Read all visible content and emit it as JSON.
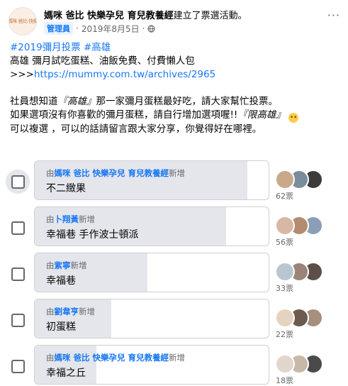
{
  "post": {
    "avatar_text": "媽咪 爸比 快樂",
    "author": "媽咪 爸比 快樂孕兒 育兒教養經",
    "action": "建立了票選活動。",
    "badge": "管理員",
    "date": "2019年8月5日",
    "separator": "·",
    "more_label": "···",
    "hashtags": "#2019彌月投票 #高雄",
    "line1": "高雄 彌月試吃蛋糕、油飯免費、付費懶人包",
    "link_prefix": ">>>",
    "link_url": "https://mummy.com.tw/archives/2965",
    "p2_a": "社員想知道",
    "p2_em": "『高雄』",
    "p2_b": "那一家彌月蛋糕最好吃，請大家幫忙投票。",
    "p3_a": "如果選項沒有你喜歡的彌月蛋糕，請自行增加選項喔!!",
    "p3_em": "『限高雄』",
    "p4": "可以複選 ，可以的話請留言跟大家分享，你覺得好在哪裡。"
  },
  "poll": {
    "by_prefix": "由",
    "added_suffix": "新增",
    "options": [
      {
        "adder": "媽咪 爸比 快樂孕兒 育兒教養經",
        "label": "不二緻果",
        "votes": "62票",
        "share": 1.0
      },
      {
        "adder": "卜翔黃",
        "label": "幸福巷 手作波士頓派",
        "votes": "56票",
        "share": 0.9
      },
      {
        "adder": "紫寧",
        "label": "幸福巷",
        "votes": "33票",
        "share": 0.53
      },
      {
        "adder": "劉韋亨",
        "label": "初蛋糕",
        "votes": "22票",
        "share": 0.36
      },
      {
        "adder": "媽咪 爸比 快樂孕兒 育兒教養經",
        "label": "幸福之丘",
        "votes": "18票",
        "share": 0.29
      }
    ]
  },
  "colors": {
    "link": "#1877f2",
    "fill": "#e4e6eb",
    "muted": "#65676b"
  }
}
